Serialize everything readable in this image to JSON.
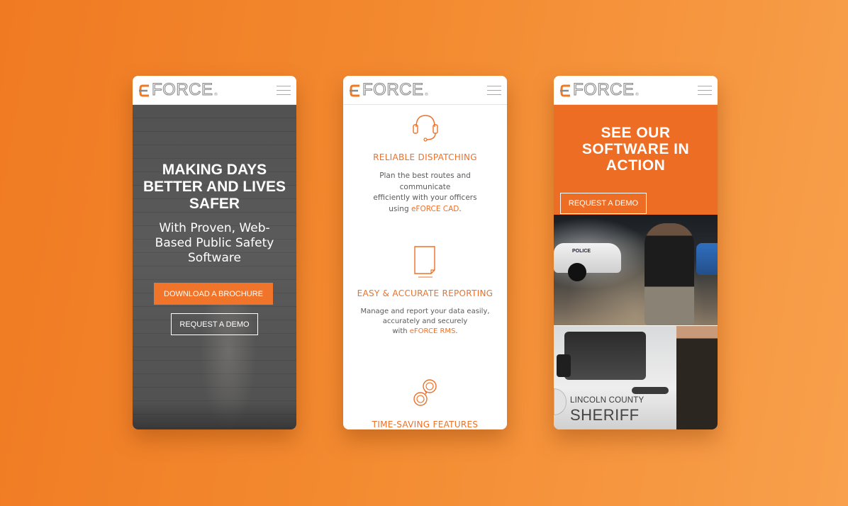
{
  "brand": {
    "logo_text": "FORCE",
    "logo_mark": "®"
  },
  "phone1": {
    "headline": "MAKING DAYS BETTER AND LIVES SAFER",
    "subheadline": "With Proven, Web-Based Public Safety Software",
    "primary_button": "DOWNLOAD A BROCHURE",
    "secondary_button": "REQUEST A DEMO"
  },
  "phone2": {
    "features": [
      {
        "icon": "headset-icon",
        "title": "RELIABLE DISPATCHING",
        "desc_lines": [
          "Plan the best routes and communicate",
          "efficiently with your officers"
        ],
        "desc_prefix": "using ",
        "link": "eFORCE CAD",
        "desc_suffix": "."
      },
      {
        "icon": "document-icon",
        "title": "EASY & ACCURATE REPORTING",
        "desc_lines": [
          "Manage and report your data easily,",
          "accurately and securely"
        ],
        "desc_prefix": "with ",
        "link": "eFORCE RMS",
        "desc_suffix": "."
      },
      {
        "icon": "handcuffs-icon",
        "title": "TIME-SAVING FEATURES"
      }
    ]
  },
  "phone3": {
    "headline": "SEE OUR SOFTWARE IN ACTION",
    "button": "REQUEST A DEMO",
    "car_label": "POLICE",
    "door_line1": "LINCOLN COUNTY",
    "door_line2": "SHERIFF"
  },
  "colors": {
    "accent": "#ef7027",
    "hero_bg": "#4f4f4f",
    "band": "#ee6d25"
  }
}
